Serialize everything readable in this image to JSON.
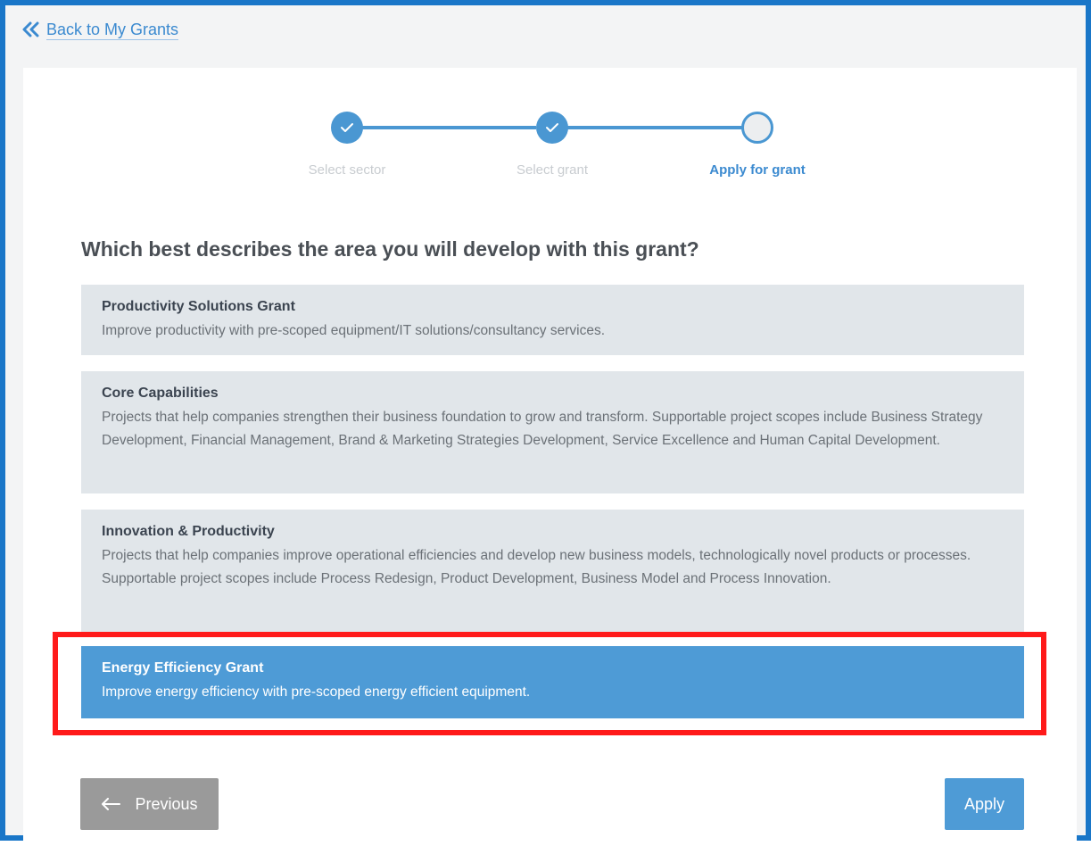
{
  "back_link": {
    "label": "Back to My Grants"
  },
  "stepper": {
    "steps": [
      {
        "label": "Select sector",
        "status": "completed"
      },
      {
        "label": "Select grant",
        "status": "completed"
      },
      {
        "label": "Apply for grant",
        "status": "current"
      }
    ]
  },
  "question": "Which best describes the area you will develop with this grant?",
  "options": [
    {
      "title": "Productivity Solutions Grant",
      "description": "Improve productivity with pre-scoped equipment/IT solutions/consultancy services.",
      "selected": false
    },
    {
      "title": "Core Capabilities",
      "description": "Projects that help companies strengthen their business foundation to grow and transform. Supportable project scopes include Business Strategy Development, Financial Management, Brand & Marketing Strategies Development, Service Excellence and Human Capital Development.",
      "selected": false
    },
    {
      "title": "Innovation & Productivity",
      "description": "Projects that help companies improve operational efficiencies and develop new business models, technologically novel products or processes. Supportable project scopes include Process Redesign, Product Development, Business Model and Process Innovation.",
      "selected": false
    },
    {
      "title": "Energy Efficiency Grant",
      "description": "Improve energy efficiency with pre-scoped energy efficient equipment.",
      "selected": true
    }
  ],
  "buttons": {
    "previous_label": "Previous",
    "apply_label": "Apply"
  },
  "colors": {
    "accent": "#4e9bd6",
    "frame_border": "#1976c8",
    "highlight": "#ff1a1a",
    "option_bg": "#e1e6ea",
    "previous_bg": "#9a9a9a"
  }
}
